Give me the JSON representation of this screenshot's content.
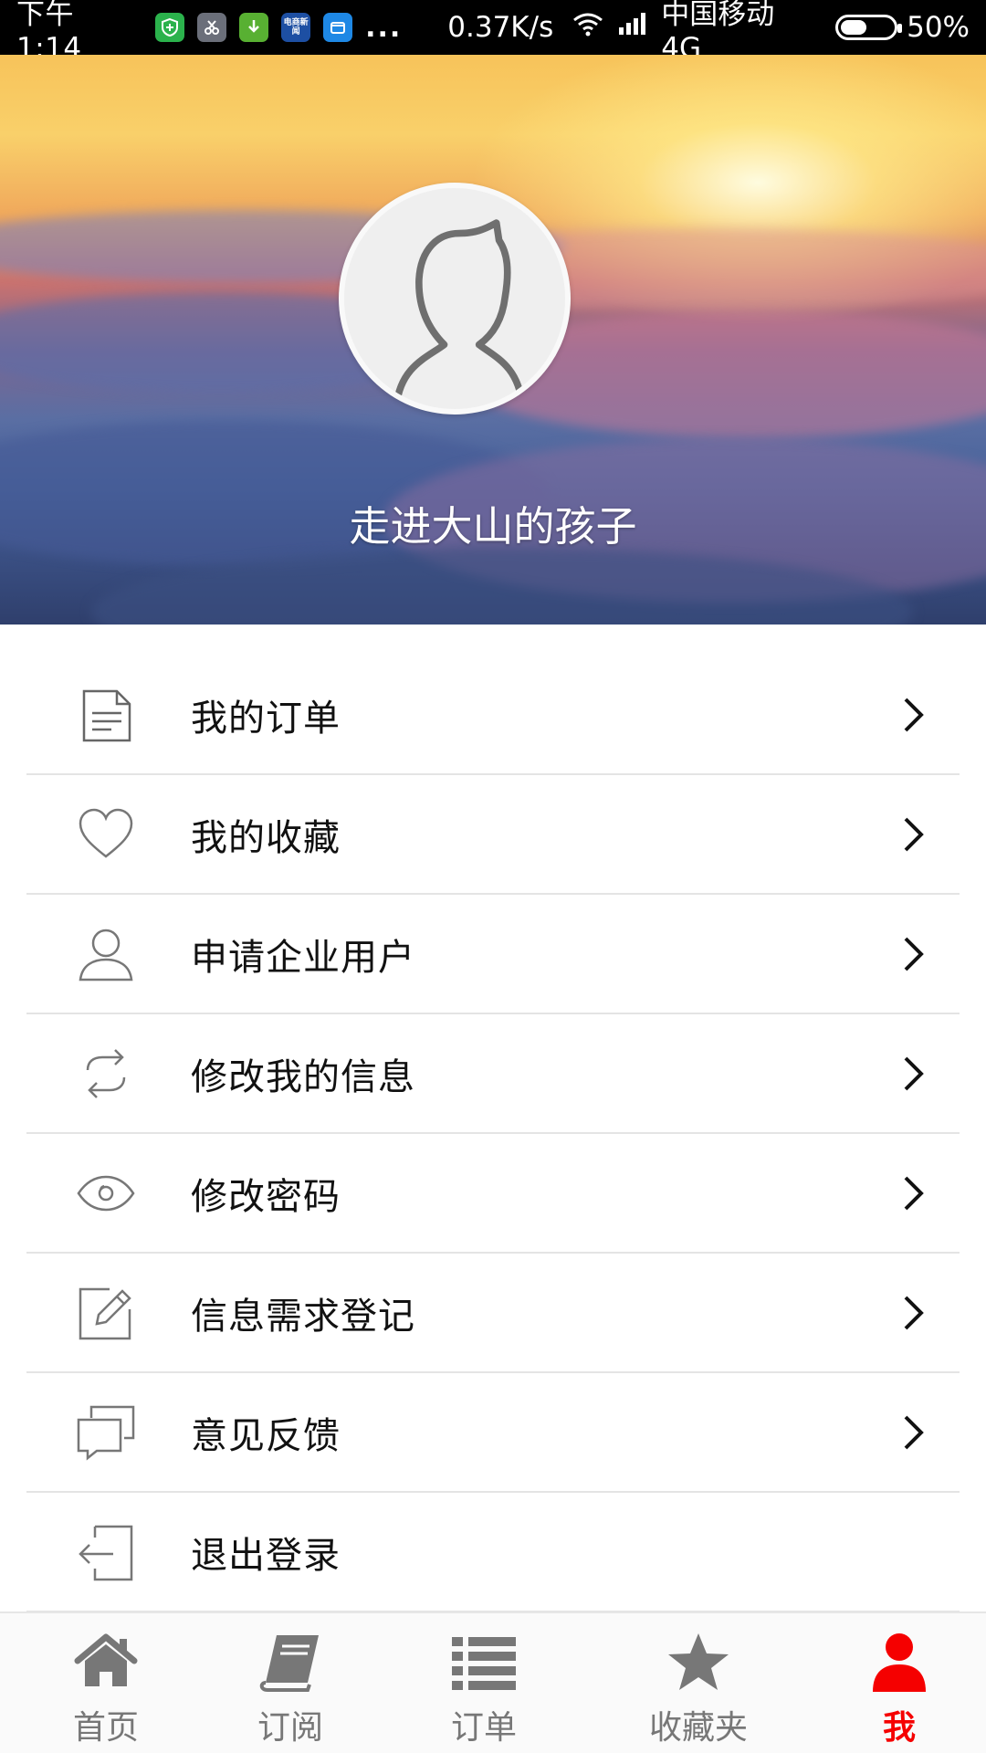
{
  "status_bar": {
    "time": "下午1:14",
    "dots": "...",
    "speed": "0.37K/s",
    "carrier": "中国移动 4G",
    "battery_percent": "50%",
    "battery_level": 0.5,
    "app_icons": [
      "shield-icon",
      "app-scissors-icon",
      "download-icon",
      "news-app-icon",
      "files-app-icon"
    ],
    "news_app_text": "电商新闻"
  },
  "profile": {
    "username": "走进大山的孩子"
  },
  "menu": {
    "items": [
      {
        "label": "我的订单",
        "icon": "document-icon",
        "has_arrow": true
      },
      {
        "label": "我的收藏",
        "icon": "heart-icon",
        "has_arrow": true
      },
      {
        "label": "申请企业用户",
        "icon": "user-icon",
        "has_arrow": true
      },
      {
        "label": "修改我的信息",
        "icon": "sync-icon",
        "has_arrow": true
      },
      {
        "label": "修改密码",
        "icon": "eye-icon",
        "has_arrow": true
      },
      {
        "label": "信息需求登记",
        "icon": "edit-icon",
        "has_arrow": true
      },
      {
        "label": "意见反馈",
        "icon": "feedback-icon",
        "has_arrow": true
      },
      {
        "label": "退出登录",
        "icon": "logout-icon",
        "has_arrow": false
      }
    ]
  },
  "tab_bar": {
    "tabs": [
      {
        "label": "首页",
        "icon": "home-icon",
        "active": false
      },
      {
        "label": "订阅",
        "icon": "book-icon",
        "active": false
      },
      {
        "label": "订单",
        "icon": "list-icon",
        "active": false
      },
      {
        "label": "收藏夹",
        "icon": "star-icon",
        "active": false
      },
      {
        "label": "我",
        "icon": "person-icon",
        "active": true
      }
    ]
  },
  "colors": {
    "active_tab": "#f50000",
    "inactive_tab": "#777777",
    "divider": "#e4e4e4"
  }
}
